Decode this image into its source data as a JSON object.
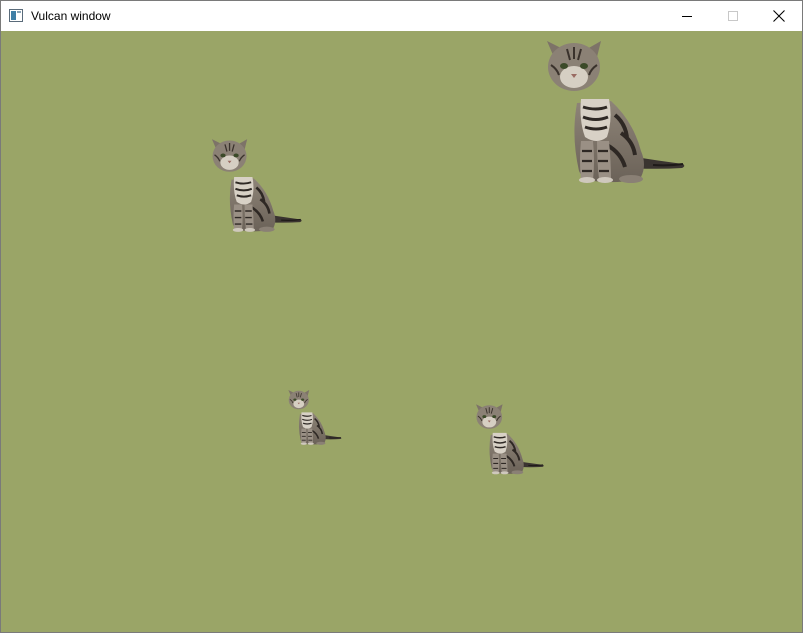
{
  "window": {
    "title": "Vulcan window",
    "icon": "window-app-icon",
    "controls": {
      "minimize": "minimize-icon",
      "maximize": "maximize-icon",
      "close": "close-icon"
    }
  },
  "canvas": {
    "background_color": "#9aa567",
    "sprites": [
      {
        "name": "tabby-cat-sprite-large",
        "icon": "tabby-cat"
      },
      {
        "name": "tabby-cat-sprite-medium",
        "icon": "tabby-cat"
      },
      {
        "name": "tabby-cat-sprite-small",
        "icon": "tabby-cat"
      },
      {
        "name": "tabby-cat-sprite-small-2",
        "icon": "tabby-cat"
      }
    ]
  }
}
